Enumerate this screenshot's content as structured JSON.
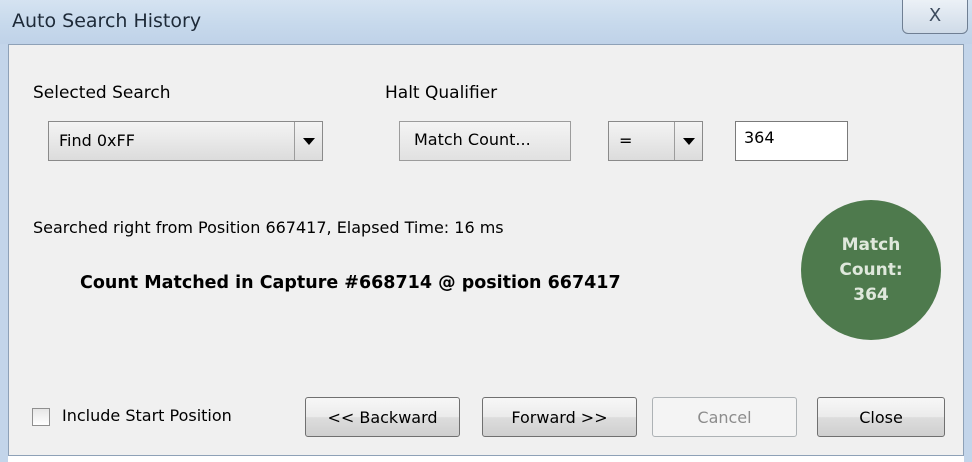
{
  "window": {
    "title": "Auto Search History",
    "close_glyph": "X"
  },
  "selected_search": {
    "label": "Selected Search",
    "value": "Find 0xFF"
  },
  "halt_qualifier": {
    "label": "Halt Qualifier",
    "match_button": "Match Count...",
    "operator": "=",
    "count_value": "364"
  },
  "status": {
    "searched_text": "Searched right from Position 667417,  Elapsed Time: 16 ms",
    "result_text": "Count Matched in Capture #668714 @ position 667417"
  },
  "indicator": {
    "line1": "Match",
    "line2": "Count:",
    "line3": "364",
    "color": "#4e7a4d"
  },
  "options": {
    "include_start_label": "Include Start Position",
    "include_start_checked": false
  },
  "buttons": {
    "backward": "<< Backward",
    "forward": "Forward >>",
    "cancel": "Cancel",
    "close": "Close"
  }
}
